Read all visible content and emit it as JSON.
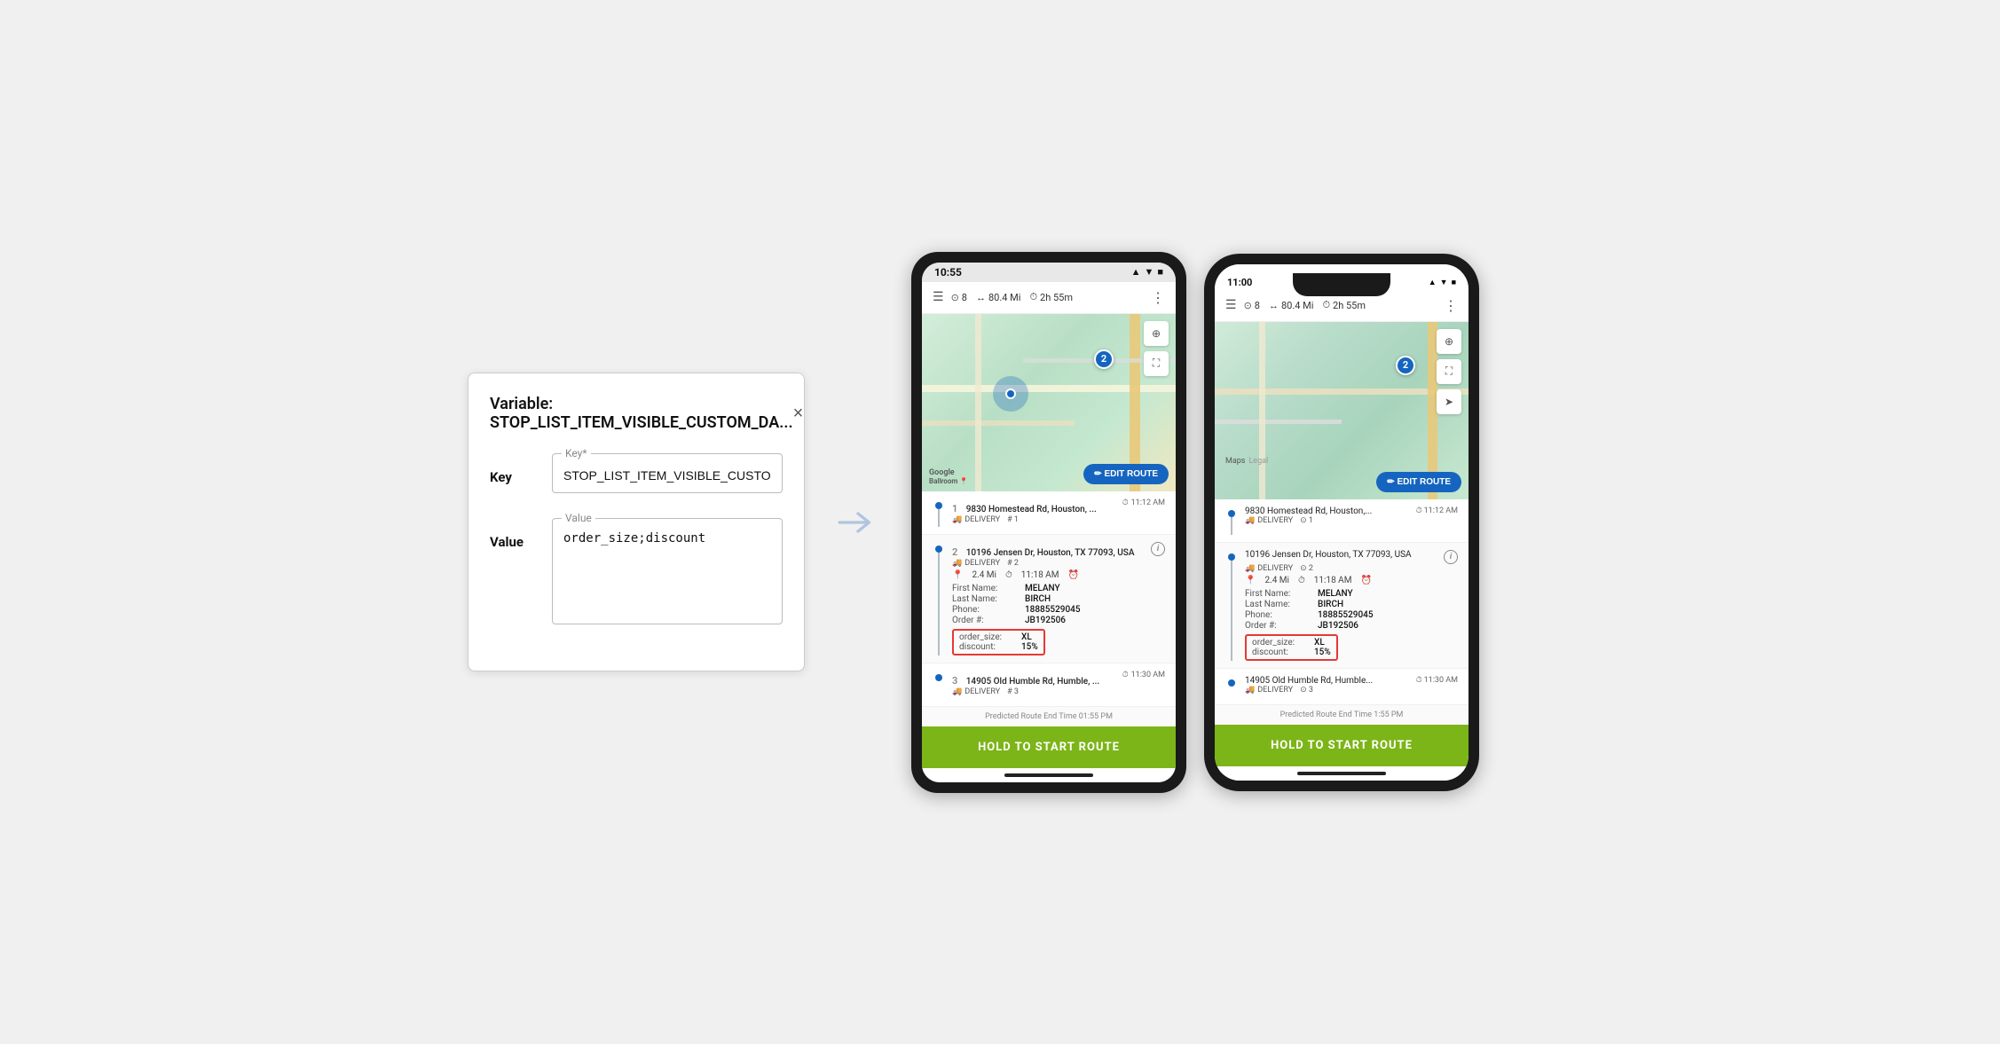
{
  "config_panel": {
    "title": "Variable: STOP_LIST_ITEM_VISIBLE_CUSTOM_DA...",
    "close_label": "×",
    "key_label": "Key",
    "key_field_label": "Key*",
    "key_value": "STOP_LIST_ITEM_VISIBLE_CUSTOM_DATA_FIELD_IDS",
    "value_label": "Value",
    "value_field_label": "Value",
    "value_value": "order_size;discount"
  },
  "arrow": "→",
  "phone_android": {
    "status_bar": {
      "time": "10:55",
      "icons": "▲ ▼ ●"
    },
    "route_header": {
      "stops": "8",
      "distance": "80.4 Mi",
      "duration": "2h 55m"
    },
    "map_marker_number": "2",
    "edit_route": "✏ EDIT ROUTE",
    "google_label": "Google",
    "stops": [
      {
        "number": "1",
        "address": "9830 Homestead Rd, Houston, ...",
        "time": "11:12 AM",
        "type": "DELIVERY",
        "stop_num": "# 1",
        "show_details": false,
        "dist": "",
        "arrival": ""
      },
      {
        "number": "2",
        "address": "10196 Jensen Dr, Houston, TX 77093, USA",
        "time": "",
        "type": "DELIVERY",
        "stop_num": "# 2",
        "show_details": true,
        "dist": "2.4 Mi",
        "arrival": "11:18 AM",
        "first_name_label": "First Name:",
        "first_name_value": "MELANY",
        "last_name_label": "Last Name:",
        "last_name_value": "BIRCH",
        "phone_label": "Phone:",
        "phone_value": "18885529045",
        "order_label": "Order #:",
        "order_value": "JB192506",
        "custom_order_size_label": "order_size:",
        "custom_order_size_value": "XL",
        "custom_discount_label": "discount:",
        "custom_discount_value": "15%"
      },
      {
        "number": "3",
        "address": "14905 Old Humble Rd, Humble, ...",
        "time": "11:30 AM",
        "type": "DELIVERY",
        "stop_num": "# 3",
        "show_details": false,
        "dist": "",
        "arrival": ""
      }
    ],
    "predicted_route": "Predicted Route End Time 01:55 PM",
    "hold_to_start": "HOLD TO START ROUTE"
  },
  "phone_ios": {
    "status_bar": {
      "time": "11:00",
      "icons": "◀ ▼ ■"
    },
    "route_header": {
      "stops": "8",
      "distance": "80.4 Mi",
      "duration": "2h 55m"
    },
    "map_marker_number": "2",
    "edit_route": "✏ EDIT ROUTE",
    "maps_label": "Maps",
    "maps_legal": "Legal",
    "stops": [
      {
        "number": "1",
        "address": "9830 Homestead Rd, Houston,...",
        "time": "11:12 AM",
        "type": "DELIVERY",
        "stop_num": "1",
        "show_details": false
      },
      {
        "number": "2",
        "address": "10196 Jensen Dr, Houston, TX 77093, USA",
        "time": "",
        "type": "DELIVERY",
        "stop_num": "2",
        "show_details": true,
        "dist": "2.4 Mi",
        "arrival": "11:18 AM",
        "first_name_label": "First Name:",
        "first_name_value": "MELANY",
        "last_name_label": "Last Name:",
        "last_name_value": "BIRCH",
        "phone_label": "Phone:",
        "phone_value": "18885529045",
        "order_label": "Order #:",
        "order_value": "JB192506",
        "custom_order_size_label": "order_size:",
        "custom_order_size_value": "XL",
        "custom_discount_label": "discount:",
        "custom_discount_value": "15%"
      },
      {
        "number": "3",
        "address": "14905 Old Humble Rd, Humble...",
        "time": "11:30 AM",
        "type": "DELIVERY",
        "stop_num": "3",
        "show_details": false
      }
    ],
    "predicted_route": "Predicted Route End Time 1:55 PM",
    "hold_to_start": "HOLD TO START ROUTE"
  }
}
